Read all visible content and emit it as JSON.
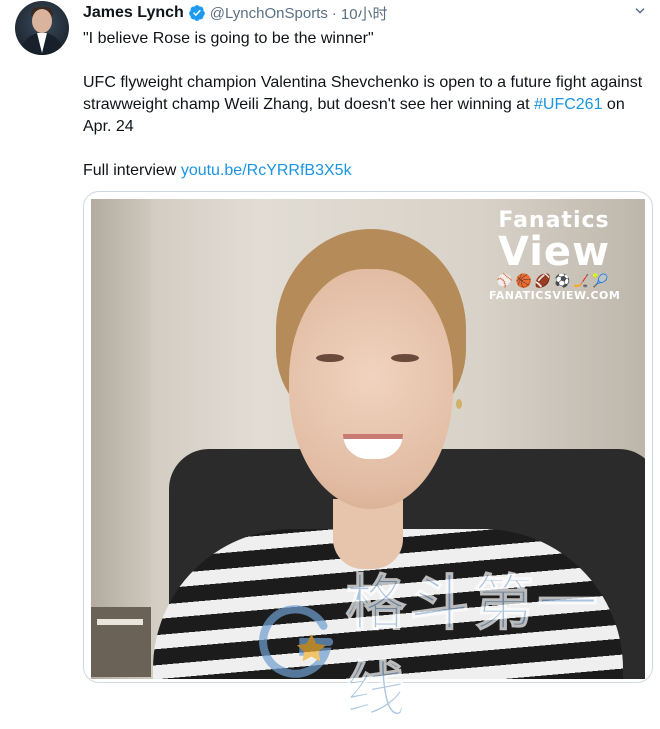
{
  "author": {
    "name": "James Lynch",
    "handle": "@LynchOnSports",
    "separator": "·",
    "time": "10小时",
    "verified_icon": "verified-badge-icon",
    "more_icon": "chevron-down-icon"
  },
  "tweet": {
    "quote": "\"I believe Rose is going to be the winner\"",
    "body_text": "UFC flyweight champion Valentina Shevchenko is open to a future fight against strawweight champ Weili Zhang, but doesn't see her winning at ",
    "hashtag": "#UFC261",
    "body_suffix": " on Apr. 24",
    "interview_label": "Full interview ",
    "interview_link": "youtu.be/RcYRRfB3X5k"
  },
  "media": {
    "logo_line1": "Fanatics",
    "logo_line2": "View",
    "logo_icons": "⚾🏀🏈⚽🏒🎾",
    "logo_url": "FANATICSVIEW.COM",
    "watermark_text": "格斗第一线"
  },
  "colors": {
    "link": "#1b95e0",
    "verified": "#1d9bf0",
    "secondary_text": "#5b7083"
  }
}
